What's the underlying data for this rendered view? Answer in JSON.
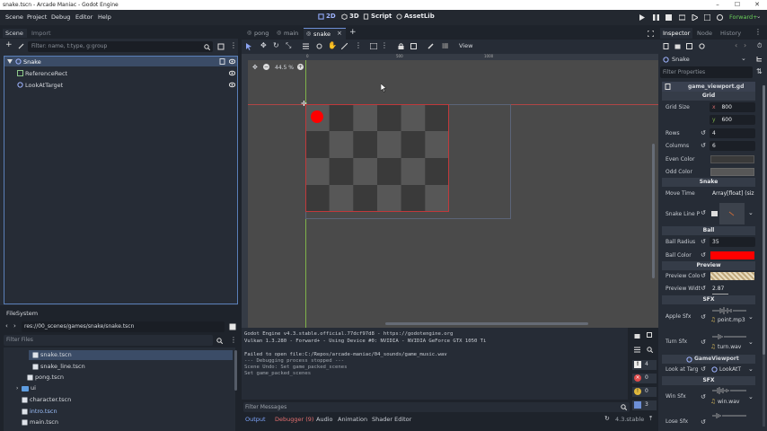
{
  "window": {
    "title": "snake.tscn - Arcade Maniac - Godot Engine",
    "min": "–",
    "max": "☐",
    "close": "✕"
  },
  "menu": {
    "items": [
      "Scene",
      "Project",
      "Debug",
      "Editor",
      "Help"
    ]
  },
  "workspaces": {
    "w2d": "2D",
    "w3d": "3D",
    "script": "Script",
    "assetlib": "AssetLib"
  },
  "renderer": "Forward+",
  "scene_dock": {
    "tabs": [
      "Scene",
      "Import"
    ],
    "filter_placeholder": "Filter: name, t:type, g:group",
    "nodes": [
      "Snake",
      "ReferenceRect",
      "LookAtTarget"
    ]
  },
  "filesystem": {
    "title": "FileSystem",
    "path": "res://00_scenes/games/snake/snake.tscn",
    "filter_placeholder": "Filter Files",
    "items": [
      "snake.tscn",
      "snake_line.tscn",
      "pong.tscn",
      "ui",
      "character.tscn",
      "intro.tscn",
      "main.tscn"
    ]
  },
  "editor_tabs": [
    "pong",
    "main",
    "snake"
  ],
  "toolbar": {
    "view": "View"
  },
  "viewport": {
    "zoom": "44.5 %",
    "ruler_labels": [
      "0",
      "500",
      "1000"
    ],
    "ball_color": "#ff0000",
    "even_color": "#3a3a3a",
    "odd_color": "#575757"
  },
  "output": {
    "lines": [
      "Godot Engine v4.3.stable.official.77dcf97d8 - https://godotengine.org",
      "Vulkan 1.3.280 - Forward+ - Using Device #0: NVIDIA - NVIDIA GeForce GTX 1050 Ti",
      "",
      "Failed to open file:C:/Repos/arcade-maniac/04_sounds/game_music.wav",
      "--- Debugging process stopped ---",
      "Scene Undo: Set game_packed_scenes",
      "Set game_packed_scenes"
    ],
    "filter_placeholder": "Filter Messages",
    "counts": [
      "4",
      "0",
      "0",
      "3"
    ]
  },
  "bottom_tabs": [
    "Output",
    "Debugger (9)",
    "Audio",
    "Animation",
    "Shader Editor"
  ],
  "version": "4.3.stable",
  "inspector": {
    "tabs": [
      "Inspector",
      "Node",
      "History"
    ],
    "object": "Snake",
    "filter_placeholder": "Filter Properties",
    "script": "game_viewport.gd",
    "sections": {
      "grid": "Grid",
      "snake": "Snake",
      "ball": "Ball",
      "preview": "Preview",
      "sfx": "SFX",
      "gameviewport": "GameViewport",
      "sfx2": "SFX"
    },
    "grid_size_label": "Grid Size",
    "grid_x": "800",
    "grid_y": "600",
    "x_lbl": "x",
    "y_lbl": "y",
    "rows_label": "Rows",
    "rows": "4",
    "columns_label": "Columns",
    "columns": "6",
    "even_color_label": "Even Color",
    "odd_color_label": "Odd Color",
    "move_time_label": "Move Time",
    "move_time": "Array[float] (siz",
    "snake_line_label": "Snake Line P",
    "ball_radius_label": "Ball Radius",
    "ball_radius": "35",
    "ball_color_label": "Ball Color",
    "preview_color_label": "Preview Colo",
    "preview_width_label": "Preview Widt",
    "preview_width": "2.87",
    "apple_sfx_label": "Apple Sfx",
    "apple_sfx": "point.mp3",
    "turn_sfx_label": "Turn Sfx",
    "turn_sfx": "turn.wav",
    "look_label": "Look at Targ",
    "look_val": "LookAtT",
    "win_sfx_label": "Win Sfx",
    "win_sfx": "win.wav",
    "lose_sfx_label": "Lose Sfx"
  }
}
